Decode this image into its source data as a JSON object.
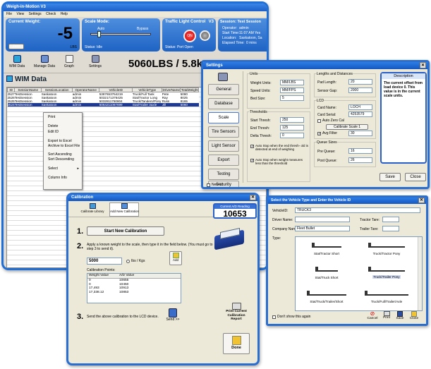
{
  "main": {
    "title": "Weigh-in-Motion V3",
    "menu": [
      "File",
      "View",
      "Settings",
      "Check",
      "Help"
    ],
    "weight_panel": {
      "label": "Current Weight:",
      "value": "-5",
      "unit": "LBS",
      "zero_label": "Zero"
    },
    "scale_panel": {
      "label": "Scale Mode:",
      "left": "Auto",
      "right": "Bypass",
      "status": "Status: Idle"
    },
    "traffic_panel": {
      "label": "Traffic Light Control",
      "version": "V3",
      "status": "Status: Port Open",
      "on_label": "ON"
    },
    "session_panel": {
      "label": "Session: Test Session",
      "rows": [
        [
          "Operator:",
          "admin"
        ],
        [
          "Start Time:",
          "11:07 AM  Yes"
        ],
        [
          "Location:",
          "Saskatoon, Sa"
        ],
        [
          "Elapsed Time:",
          "0 mins"
        ]
      ]
    },
    "toolbar": [
      {
        "icon": "wim-data-icon",
        "label": "WIM Data"
      },
      {
        "icon": "manage-data-icon",
        "label": "Manage Data"
      },
      {
        "icon": "graph-icon",
        "label": "Graph"
      },
      {
        "icon": "settings-icon",
        "label": "Settings"
      }
    ],
    "total": "5060LBS / 5.8k",
    "section_title": "WIM Data",
    "table": {
      "headers": [
        "ID",
        "SessionName",
        "SessionLocation",
        "OperatorName",
        "VehicleID",
        "VehicleType",
        "DriverName",
        "TotalWeight"
      ],
      "rows": [
        [
          "2527",
          "TestSession",
          "Saskatoon",
          "admin",
          "5387653764219",
          "Truck/Full Tank",
          "Pete",
          "5080"
        ],
        [
          "2526",
          "TestSession",
          "Saskatoon",
          "admin",
          "5032171376425",
          "Stat/Tractor Long",
          "Ray",
          "8025"
        ],
        [
          "2525",
          "TestSession",
          "Saskatoon",
          "admin",
          "5032811760804",
          "Truck/Tandem/Pony",
          "Russ",
          "8165"
        ],
        [
          "2524",
          "TestSession",
          "Saskatoon",
          "admin",
          "5064211087699",
          "Stat/Trailer 3axle",
          "Jill",
          "5060"
        ]
      ]
    },
    "context_menu": [
      "Print",
      "Delete",
      "Edit ID",
      "Export to Excel",
      "Archive to Excel File",
      "Sort Ascending",
      "Sort Descending",
      "Select",
      "Column Info"
    ]
  },
  "settings": {
    "title": "Settings",
    "nav": [
      "General",
      "Database",
      "Scale",
      "Tire Sensors",
      "Light Sensor",
      "Export",
      "Testing",
      "Security"
    ],
    "units_group": "Units",
    "units": [
      [
        "Weight Units:",
        "MM/LBS"
      ],
      [
        "Speed Units:",
        "MM/FPS"
      ],
      [
        "Bed Size:",
        "5"
      ]
    ],
    "thresh_group": "Thresholds",
    "thresholds": [
      [
        "Start Thresh:",
        "250"
      ],
      [
        "End Thresh:",
        "125"
      ],
      [
        "Delta Thresh:",
        "0"
      ]
    ],
    "check1": "Auto Stop when the end thresh- old is detected at end of weighing",
    "check2": "Auto Stop when weight measures less than the threshold",
    "lengths_group": "Lengths and Distances",
    "lengths": [
      [
        "Pad Length:",
        "20"
      ],
      [
        "Sensor Gap:",
        "2000"
      ]
    ],
    "lcd_group": "LCD",
    "lcd": [
      [
        "Card Name:",
        "LOCH"
      ],
      [
        "Card Serial:",
        "4253579"
      ]
    ],
    "auto_zero": "Auto Zero Cal",
    "calibrate": "Calibrate Scale 1",
    "avg_label": "Avg Filter",
    "avg_value": "30",
    "queue_group": "Queue Sizes",
    "queue": [
      [
        "Pre Queue:",
        "16"
      ],
      [
        "Post Queue:",
        "26"
      ]
    ],
    "desc_title": "Description",
    "desc_text": "The current offset from load device 0. This value is in the current scale units.",
    "save": "Save",
    "close": "Close",
    "new_ui": "New UI"
  },
  "calibration": {
    "title": "Calibration",
    "tabs": [
      "Calibrate Library",
      "Add New Calibration"
    ],
    "reading_label": "Current A/D Reading",
    "reading": "10653",
    "step1": "Start New Calibration",
    "step2_text": "Apply a known weight to the scale, then type it in the field below. (You must go to step 3 to send it).",
    "weight_value": "5000",
    "unit_option": "Ibs / Kgs",
    "add_label": "Add",
    "points_label": "Calibration Points:",
    "points_headers": [
      "Weight Value",
      "A/D Value"
    ],
    "points": [
      [
        "0",
        "10655"
      ],
      [
        "0",
        "10450"
      ],
      [
        "17,493",
        "10913"
      ],
      [
        "17,338.12",
        "10853"
      ]
    ],
    "step3_text": "Send the above calibration to the LCD device.",
    "send": "Send >>",
    "print": "Print Current Calibration Report",
    "done": "Done"
  },
  "vehicle": {
    "title": "Select the Vehicle Type and Enter the Vehicle ID",
    "fields": [
      [
        "VehicleID:",
        "TRUCK3"
      ],
      [
        "Driver Name:",
        ""
      ],
      [
        "Company Name:",
        "Fleet Bullet"
      ]
    ],
    "tractor_tare": "Tractor Tare:",
    "trailer_tare": "Trailer Tare:",
    "type_label": "Type:",
    "types": [
      "Stat/Tractor Short",
      "Truck/Tractor Pony",
      "Stat/Truck Short",
      "Truck/Trailer Pony",
      "Stat/Truck/Trailer/Short",
      "Truck/Full/Trailer/Axle"
    ],
    "dont_show": "Don't show this again",
    "buttons": [
      "Cancel",
      "Print",
      "Save",
      "Close"
    ]
  }
}
